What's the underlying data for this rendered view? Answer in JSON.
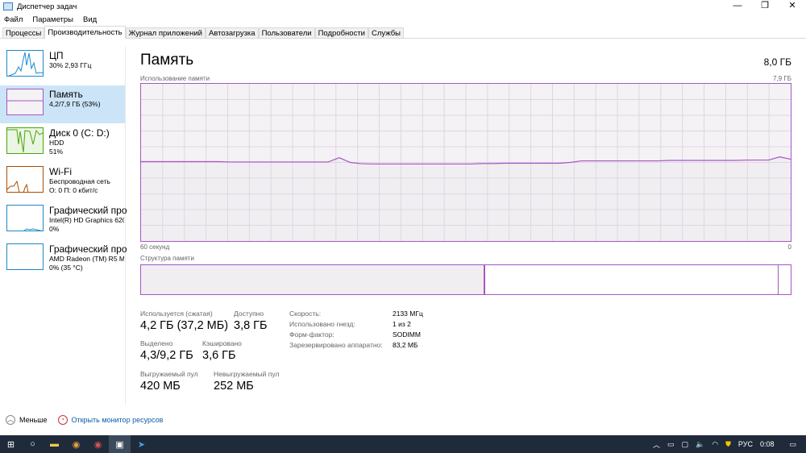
{
  "window": {
    "title": "Диспетчер задач",
    "minimize": "—",
    "restore": "❐",
    "close": "✕"
  },
  "menu": [
    "Файл",
    "Параметры",
    "Вид"
  ],
  "tabs": [
    "Процессы",
    "Производительность",
    "Журнал приложений",
    "Автозагрузка",
    "Пользователи",
    "Подробности",
    "Службы"
  ],
  "sidebar": [
    {
      "name": "ЦП",
      "sub1": "30% 2,93 ГГц",
      "sub2": "",
      "color": "#1d8ac9"
    },
    {
      "name": "Память",
      "sub1": "4,2/7,9 ГБ (53%)",
      "sub2": "",
      "color": "#a756c2"
    },
    {
      "name": "Диск 0 (C: D:)",
      "sub1": "HDD",
      "sub2": "51%",
      "color": "#4da60c"
    },
    {
      "name": "Wi-Fi",
      "sub1": "Беспроводная сеть",
      "sub2": "О: 0 П: 0 кбит/с",
      "color": "#a74f01"
    },
    {
      "name": "Графический про",
      "sub1": "Intel(R) HD Graphics 620",
      "sub2": "0%",
      "color": "#1d8ac9"
    },
    {
      "name": "Графический про",
      "sub1": "AMD Radeon (TM) R5 M",
      "sub2": "0% (35 °C)",
      "color": "#1d8ac9"
    }
  ],
  "main": {
    "title": "Память",
    "total": "8,0 ГБ",
    "usage_label": "Использование памяти",
    "usage_max": "7,9 ГБ",
    "time_left": "60 секунд",
    "time_right": "0",
    "structure_label": "Структура памяти",
    "stats": {
      "in_use_label": "Используется (сжатая)",
      "in_use": "4,2 ГБ (37,2 МБ)",
      "available_label": "Доступно",
      "available": "3,8 ГБ",
      "committed_label": "Выделено",
      "committed": "4,3/9,2 ГБ",
      "cached_label": "Кэшировано",
      "cached": "3,6 ГБ",
      "paged_label": "Выгружаемый пул",
      "paged": "420 МБ",
      "nonpaged_label": "Невыгружаемый пул",
      "nonpaged": "252 МБ"
    },
    "details": [
      {
        "k": "Скорость:",
        "v": "2133 МГц"
      },
      {
        "k": "Использовано гнезд:",
        "v": "1 из 2"
      },
      {
        "k": "Форм-фактор:",
        "v": "SODIMM"
      },
      {
        "k": "Зарезервировано аппаратно:",
        "v": "83,2 МБ"
      }
    ]
  },
  "footer": {
    "less": "Меньше",
    "monitor": "Открыть монитор ресурсов"
  },
  "tray": {
    "lang": "РУС",
    "time": "0:08"
  },
  "chart_data": {
    "type": "line",
    "title": "Использование памяти",
    "ylim": [
      0,
      100
    ],
    "xlabel": "60 секунд",
    "values": [
      50.5,
      50.5,
      50.5,
      50.5,
      50.5,
      50.5,
      50.5,
      50.5,
      50.3,
      50.3,
      50.3,
      50.3,
      50.3,
      50.3,
      50.3,
      50.3,
      50.3,
      50.3,
      53,
      50,
      49.2,
      49,
      49,
      49,
      49,
      49,
      49,
      49,
      49,
      49,
      49,
      49.3,
      49.3,
      49.5,
      49.5,
      49.5,
      49.5,
      49.5,
      49.5,
      50,
      51,
      51,
      51,
      51,
      51,
      51,
      51,
      51,
      51.3,
      51.3,
      51.3,
      51.3,
      51.3,
      51.3,
      51.3,
      51.5,
      51.5,
      51.5,
      53.5,
      52
    ],
    "structure": {
      "in_use": 0.527,
      "modified": 0.002,
      "standby": 0.451,
      "free": 0.02
    }
  }
}
